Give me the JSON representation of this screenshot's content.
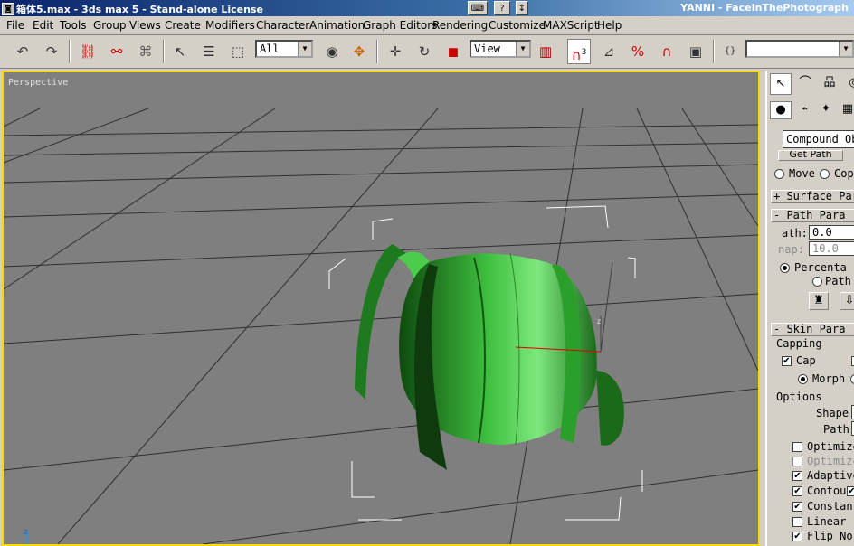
{
  "window": {
    "title": "箱体5.max - 3ds max 5 - Stand-alone License",
    "right_title": "YANNI - FaceInThePhotograph",
    "help_button": "?"
  },
  "menu": [
    "File",
    "Edit",
    "Tools",
    "Group",
    "Views",
    "Create",
    "Modifiers",
    "Character",
    "Animation",
    "Graph Editors",
    "Rendering",
    "Customize",
    "MAXScript",
    "Help"
  ],
  "toolbar": {
    "selection_filter": "All",
    "reference_coord": "View",
    "snap_label": "3",
    "icons": [
      "undo-icon",
      "redo-icon",
      "link-icon",
      "unlink-icon",
      "bind-space-warp-icon",
      "select-icon",
      "select-by-name-icon",
      "region-select-icon",
      "select-move-icon",
      "select-rotate-icon",
      "select-scale-icon",
      "pivot-icon",
      "mirror-icon",
      "snap-icon",
      "angle-snap-icon",
      "percent-snap-icon",
      "spinner-snap-icon",
      "named-selection-icon",
      "abc-icon"
    ]
  },
  "viewport": {
    "label": "Perspective",
    "background": "#7f7f7f",
    "active_border": "#ffd800",
    "object_color": "#3fbf3f",
    "axis_z": "z"
  },
  "panel": {
    "tabs": [
      "create-tab",
      "modify-tab",
      "hierarchy-tab",
      "motion-tab"
    ],
    "category_dropdown": "Compound Ob",
    "get_path_button": "Get Path",
    "move_label": "Move",
    "copy_label": "Copy",
    "rollouts": {
      "surface": "+ Surface Par",
      "path": "- Path Para",
      "skin": "- Skin Para"
    },
    "path_label": "ath:",
    "path_value": "0.0",
    "snap_label": "nap:",
    "snap_value": "10.0",
    "percentage_label": "Percenta",
    "path_steps_label": "Path",
    "capping_title": "Capping",
    "cap_label": "Cap",
    "morph_label": "Morph",
    "options_title": "Options",
    "shape_label": "Shape",
    "path2_label": "Path",
    "options": [
      {
        "label": "Optimize",
        "checked": false,
        "disabled": false
      },
      {
        "label": "Optimize",
        "checked": false,
        "disabled": true
      },
      {
        "label": "Adaptive",
        "checked": true,
        "disabled": false
      },
      {
        "label": "Contou",
        "checked": true,
        "disabled": false
      },
      {
        "label": "Constant",
        "checked": true,
        "disabled": false
      },
      {
        "label": "Linear",
        "checked": false,
        "disabled": false
      },
      {
        "label": "Flip No",
        "checked": true,
        "disabled": false
      }
    ]
  }
}
